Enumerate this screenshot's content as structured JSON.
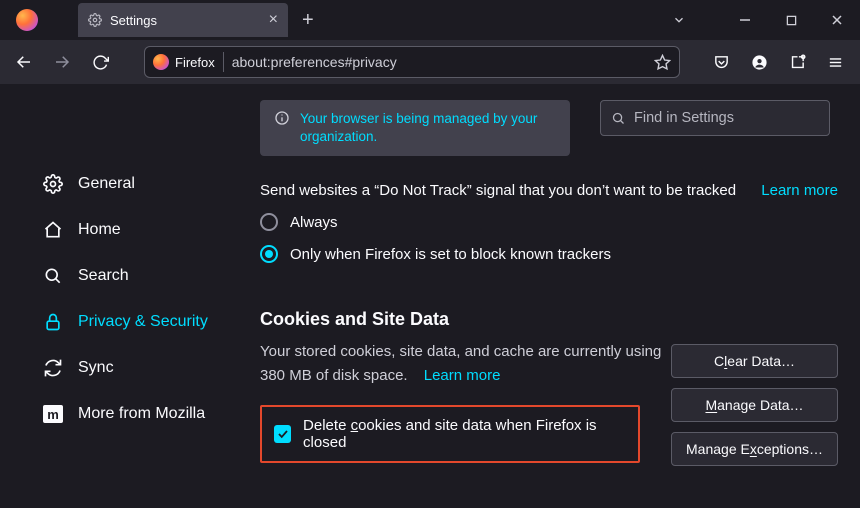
{
  "window": {
    "tab_title": "Settings",
    "url_chip": "Firefox",
    "url": "about:preferences#privacy"
  },
  "banner": {
    "message": "Your browser is being managed by your organization."
  },
  "search": {
    "placeholder": "Find in Settings"
  },
  "sidebar": {
    "general": "General",
    "home": "Home",
    "search": "Search",
    "privacy": "Privacy & Security",
    "sync": "Sync",
    "more": "More from Mozilla"
  },
  "dnt": {
    "text": "Send websites a “Do Not Track” signal that you don’t want to be tracked",
    "learn_more": "Learn more",
    "opt_always": "Always",
    "opt_known": "Only when Firefox is set to block known trackers"
  },
  "cookies": {
    "heading": "Cookies and Site Data",
    "desc_part1": "Your stored cookies, site data, and cache are currently using 380 MB of disk space.",
    "learn_more": "Learn more",
    "delete_on_close": "Delete cookies and site data when Firefox is closed"
  },
  "buttons": {
    "clear_data": "Clear Data…",
    "manage_data": "Manage Data…",
    "manage_exceptions": "Manage Exceptions…"
  }
}
